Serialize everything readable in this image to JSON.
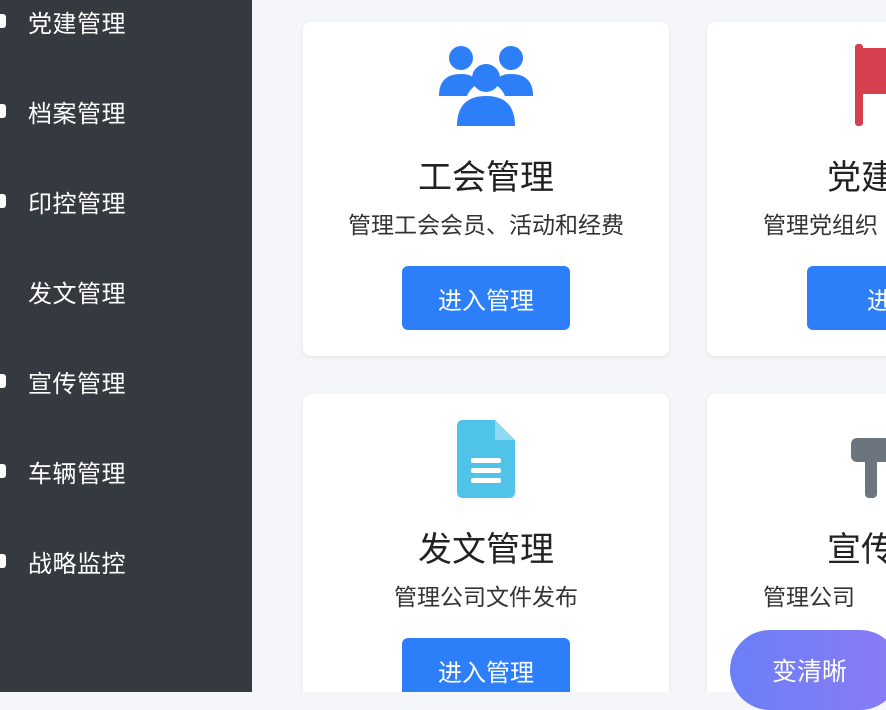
{
  "sidebar": {
    "items": [
      {
        "label": "党建管理"
      },
      {
        "label": "档案管理"
      },
      {
        "label": "印控管理"
      },
      {
        "label": "发文管理"
      },
      {
        "label": "宣传管理"
      },
      {
        "label": "车辆管理"
      },
      {
        "label": "战略监控"
      }
    ]
  },
  "cards": [
    {
      "title": "工会管理",
      "desc": "管理工会会员、活动和经费",
      "button": "进入管理",
      "icon": "users-icon",
      "icon_color": "#2d7ff9"
    },
    {
      "title": "党建",
      "desc": "管理党组织",
      "button": "进入",
      "icon": "flag-icon",
      "icon_color": "#d6404e"
    },
    {
      "title": "发文管理",
      "desc": "管理公司文件发布",
      "button": "进入管理",
      "icon": "document-icon",
      "icon_color": "#4fc3e8"
    },
    {
      "title": "宣传",
      "desc": "管理公司",
      "button": "",
      "icon": "bullhorn-icon",
      "icon_color": "#6c757d"
    }
  ],
  "float_button": {
    "label": "变清晰"
  },
  "colors": {
    "sidebar_bg": "#343a40",
    "accent": "#2d7ff9",
    "page_bg": "#f4f6f9"
  }
}
